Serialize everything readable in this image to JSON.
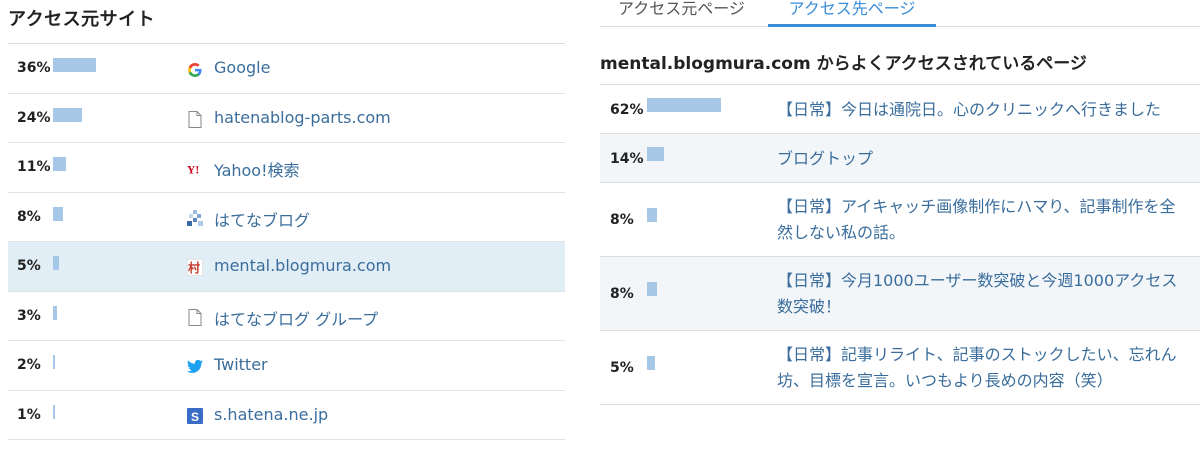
{
  "left": {
    "title": "アクセス元サイト",
    "sources": [
      {
        "percent": "36%",
        "share": 36,
        "icon": "google-icon",
        "label": "Google",
        "highlight": false
      },
      {
        "percent": "24%",
        "share": 24,
        "icon": "document-icon",
        "label": "hatenablog-parts.com",
        "highlight": false
      },
      {
        "percent": "11%",
        "share": 11,
        "icon": "yahoo-icon",
        "label": "Yahoo!検索",
        "highlight": false
      },
      {
        "percent": "8%",
        "share": 8,
        "icon": "hatena-blog-icon",
        "label": "はてなブログ",
        "highlight": false
      },
      {
        "percent": "5%",
        "share": 5,
        "icon": "blogmura-icon",
        "label": "mental.blogmura.com",
        "highlight": true
      },
      {
        "percent": "3%",
        "share": 3,
        "icon": "document-icon",
        "label": "はてなブログ グループ",
        "highlight": false
      },
      {
        "percent": "2%",
        "share": 2,
        "icon": "twitter-icon",
        "label": "Twitter",
        "highlight": false
      },
      {
        "percent": "1%",
        "share": 1,
        "icon": "hatena-s-icon",
        "label": "s.hatena.ne.jp",
        "highlight": false
      }
    ]
  },
  "right": {
    "tabs": [
      {
        "label": "アクセス元ページ",
        "active": false
      },
      {
        "label": "アクセス先ページ",
        "active": true
      }
    ],
    "heading": "mental.blogmura.com からよくアクセスされているページ",
    "pages": [
      {
        "percent": "62%",
        "share": 62,
        "label": "【日常】今日は通院日。心のクリニックへ行きました"
      },
      {
        "percent": "14%",
        "share": 14,
        "label": "ブログトップ"
      },
      {
        "percent": "8%",
        "share": 8,
        "label": "【日常】アイキャッチ画像制作にハマり、記事制作を全然しない私の話。"
      },
      {
        "percent": "8%",
        "share": 8,
        "label": "【日常】今月1000ユーザー数突破と今週1000アクセス数突破！"
      },
      {
        "percent": "5%",
        "share": 5,
        "label": "【日常】記事リライト、記事のストックしたい、忘れん坊、目標を宣言。いつもより長めの内容（笑）"
      }
    ]
  },
  "colors": {
    "bar": "#a6c8e6",
    "link": "#3a6d9c",
    "active_tab": "#3a8dd8",
    "highlight_row": "#e2eef6"
  }
}
